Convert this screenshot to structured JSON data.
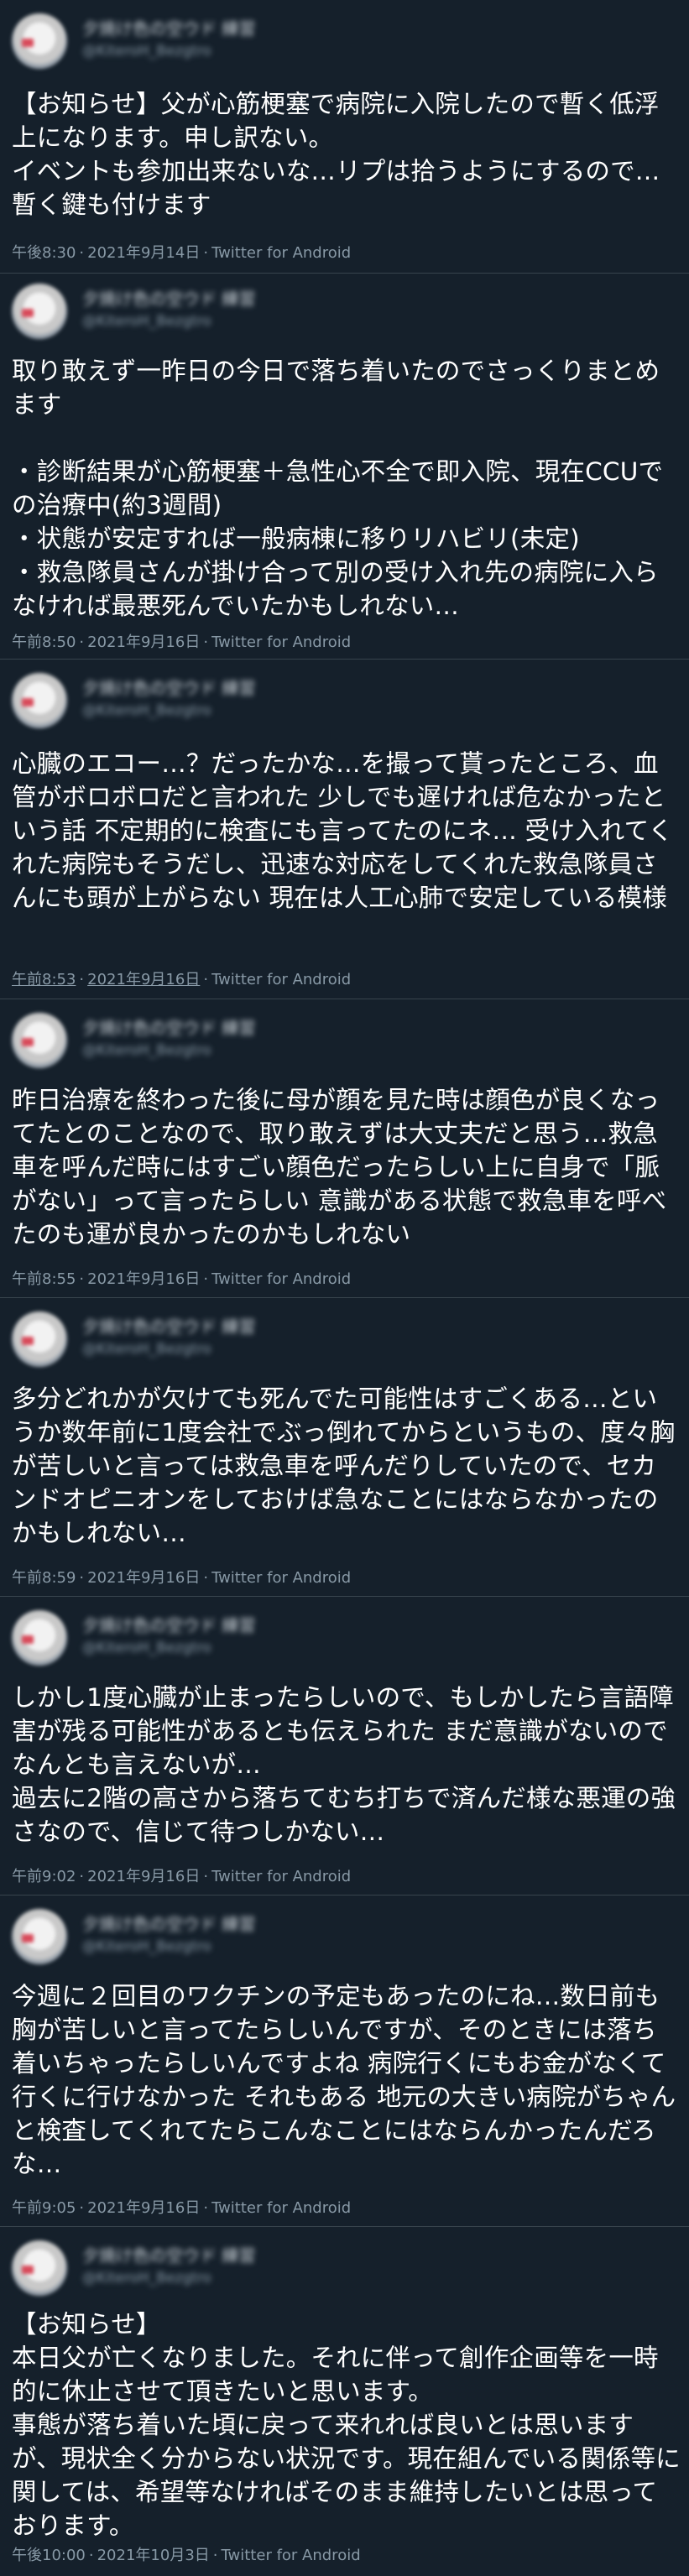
{
  "tweets": [
    {
      "author_name": "夕焼け色の空ウド 練習",
      "author_handle": "@KiteroH_Bezgtro",
      "body": "【お知らせ】父が心筋梗塞で病院に入院したので暫く低浮上になります。申し訳ない。\nイベントも参加出来ないな…リプは拾うようにするので…暫く鍵も付けます",
      "time": "午後8:30",
      "date": "2021年9月14日",
      "client": "Twitter for Android"
    },
    {
      "author_name": "夕焼け色の空ウド 練習",
      "author_handle": "@KiteroH_Bezgtro",
      "body": "取り敢えず一昨日の今日で落ち着いたのでさっくりまとめます\n\n・診断結果が心筋梗塞＋急性心不全で即入院、現在CCUでの治療中(約3週間)\n・状態が安定すれば一般病棟に移りリハビリ(未定)\n・救急隊員さんが掛け合って別の受け入れ先の病院に入らなければ最悪死んでいたかもしれない…",
      "time": "午前8:50",
      "date": "2021年9月16日",
      "client": "Twitter for Android"
    },
    {
      "author_name": "夕焼け色の空ウド 練習",
      "author_handle": "@KiteroH_Bezgtro",
      "body": "心臓のエコー…？だったかな…を撮って貰ったところ、血管がボロボロだと言われた 少しでも遅ければ危なかったという話 不定期的に検査にも言ってたのにネ… 受け入れてくれた病院もそうだし、迅速な対応をしてくれた救急隊員さんにも頭が上がらない 現在は人工心肺で安定している模様",
      "time": "午前8:53",
      "date": "2021年9月16日",
      "client": "Twitter for Android"
    },
    {
      "author_name": "夕焼け色の空ウド 練習",
      "author_handle": "@KiteroH_Bezgtro",
      "body": "昨日治療を終わった後に母が顔を見た時は顔色が良くなってたとのことなので、取り敢えずは大丈夫だと思う…救急車を呼んだ時にはすごい顔色だったらしい上に自身で「脈がない」って言ったらしい 意識がある状態で救急車を呼べたのも運が良かったのかもしれない",
      "time": "午前8:55",
      "date": "2021年9月16日",
      "client": "Twitter for Android"
    },
    {
      "author_name": "夕焼け色の空ウド 練習",
      "author_handle": "@KiteroH_Bezgtro",
      "body": "多分どれかが欠けても死んでた可能性はすごくある…というか数年前に1度会社でぶっ倒れてからというもの、度々胸が苦しいと言っては救急車を呼んだりしていたので、セカンドオピニオンをしておけば急なことにはならなかったのかもしれない…",
      "time": "午前8:59",
      "date": "2021年9月16日",
      "client": "Twitter for Android"
    },
    {
      "author_name": "夕焼け色の空ウド 練習",
      "author_handle": "@KiteroH_Bezgtro",
      "body": "しかし1度心臓が止まったらしいので、もしかしたら言語障害が残る可能性があるとも伝えられた まだ意識がないのでなんとも言えないが…\n過去に2階の高さから落ちてむち打ちで済んだ様な悪運の強さなので、信じて待つしかない…",
      "time": "午前9:02",
      "date": "2021年9月16日",
      "client": "Twitter for Android"
    },
    {
      "author_name": "夕焼け色の空ウド 練習",
      "author_handle": "@KiteroH_Bezgtro",
      "body": "今週に２回目のワクチンの予定もあったのにね…数日前も胸が苦しいと言ってたらしいんですが、そのときには落ち着いちゃったらしいんですよね 病院行くにもお金がなくて行くに行けなかった それもある 地元の大きい病院がちゃんと検査してくれてたらこんなことにはならんかったんだろな…",
      "time": "午前9:05",
      "date": "2021年9月16日",
      "client": "Twitter for Android"
    },
    {
      "author_name": "夕焼け色の空ウド 練習",
      "author_handle": "@KiteroH_Bezgtro",
      "body": "【お知らせ】\n本日父が亡くなりました。それに伴って創作企画等を一時的に休止させて頂きたいと思います。\n事態が落ち着いた頃に戻って来れれば良いとは思いますが、現状全く分からない状況です。現在組んでいる関係等に関しては、希望等なければそのまま維持したいとは思っております。",
      "time": "午後10:00",
      "date": "2021年10月3日",
      "client": "Twitter for Android"
    }
  ],
  "meta_separator": "·"
}
